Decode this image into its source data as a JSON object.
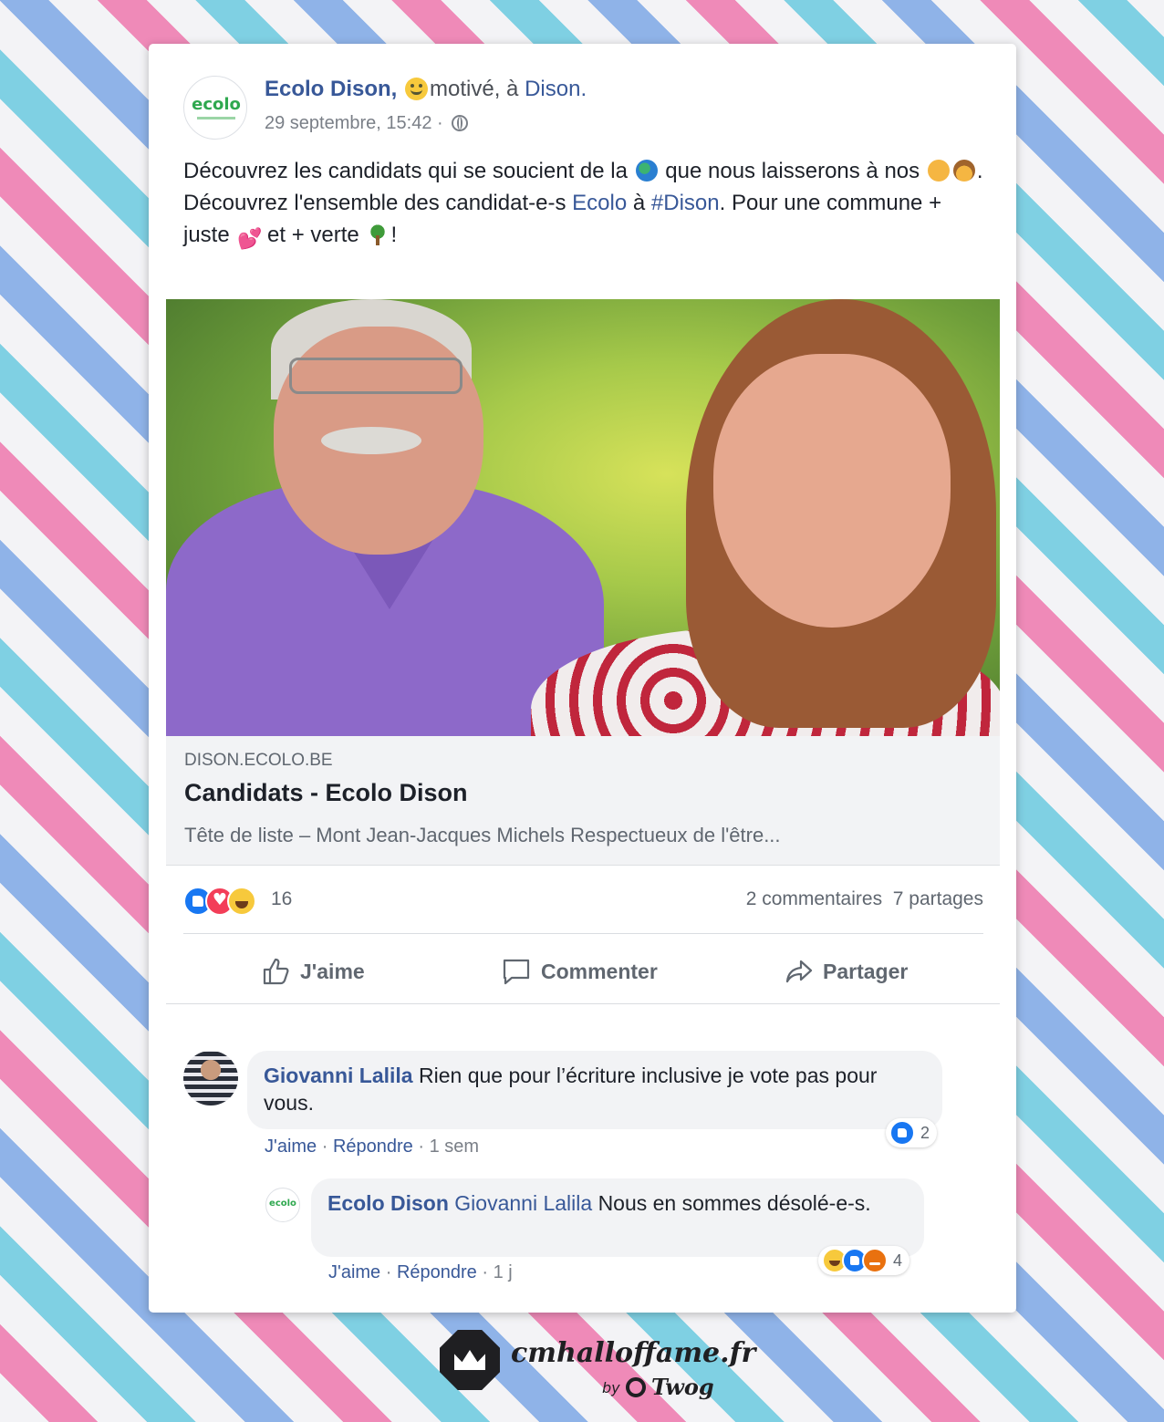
{
  "post": {
    "page_name": "Ecolo Dison,",
    "avatar_logo": "ecolo",
    "feeling": "motivé, à",
    "place": "Dison.",
    "timestamp": "29 septembre, 15:42 ·",
    "privacy_icon": "globe-icon",
    "text": {
      "line1_a": "Découvrez les candidats qui se soucient de la",
      "line1_b": "que nous laisserons à nos",
      "line1_end": ".",
      "line2_a": "Découvrez l'ensemble des candidat-e-s",
      "line2_link1": "Ecolo",
      "line2_b": "à",
      "line2_hashtag": "#Dison",
      "line2_c": ". Pour une commune + juste",
      "line2_d": "et + verte",
      "line2_end": "!"
    },
    "emojis": [
      "globe",
      "boy",
      "girl",
      "two-hearts",
      "tree",
      "grinning-face"
    ]
  },
  "link_preview": {
    "domain": "DISON.ECOLO.BE",
    "title": "Candidats - Ecolo Dison",
    "description": "Tête de liste – Mont Jean-Jacques Michels Respectueux de l'être..."
  },
  "engagement": {
    "reaction_count": "16",
    "comments": "2 commentaires",
    "shares": "7 partages"
  },
  "actions": {
    "like": "J'aime",
    "comment": "Commenter",
    "share": "Partager"
  },
  "comments": [
    {
      "author": "Giovanni Lalila",
      "text": "Rien que pour l’écriture inclusive je vote pas pour vous.",
      "like_label": "J'aime",
      "reply_label": "Répondre",
      "age": "1 sem",
      "reaction_count": "2"
    },
    {
      "author": "Ecolo Dison",
      "mention": "Giovanni Lalila",
      "text": "Nous en sommes désolé-e-s.",
      "like_label": "J'aime",
      "reply_label": "Répondre",
      "age": "1 j",
      "reaction_count": "4"
    }
  ],
  "brand": {
    "name": "cmhalloffame.fr",
    "by": "by",
    "partner": "Twog"
  },
  "colors": {
    "facebook_blue": "#385898",
    "like_blue": "#1877f2",
    "love_red": "#f33e58",
    "stripe_pink": "#ef8ab8",
    "stripe_cyan": "#7fd0e3",
    "stripe_blue": "#8fb3e8"
  }
}
